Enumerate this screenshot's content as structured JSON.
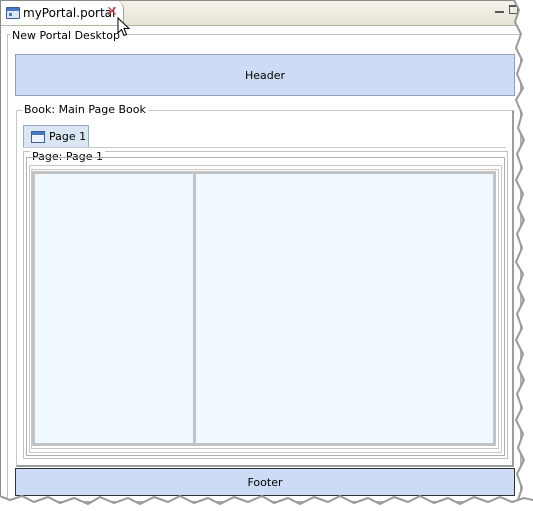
{
  "editor": {
    "tab_title": "myPortal.portal",
    "tab_icon": "portal-file-icon",
    "close_icon": "close-icon"
  },
  "window_controls": {
    "minimize_icon": "minimize-icon",
    "maximize_icon": "maximize-icon"
  },
  "desktop": {
    "label": "New Portal Desktop",
    "header_label": "Header",
    "footer_label": "Footer"
  },
  "book": {
    "label": "Book: Main Page Book",
    "tabs": [
      {
        "label": "Page 1",
        "icon": "page-icon"
      }
    ]
  },
  "page": {
    "label": "Page: Page 1",
    "columns": 2
  },
  "colors": {
    "header_footer_fill": "#cddcf4",
    "placeholder_fill": "#eff7ff",
    "close_red": "#c94a4a"
  }
}
